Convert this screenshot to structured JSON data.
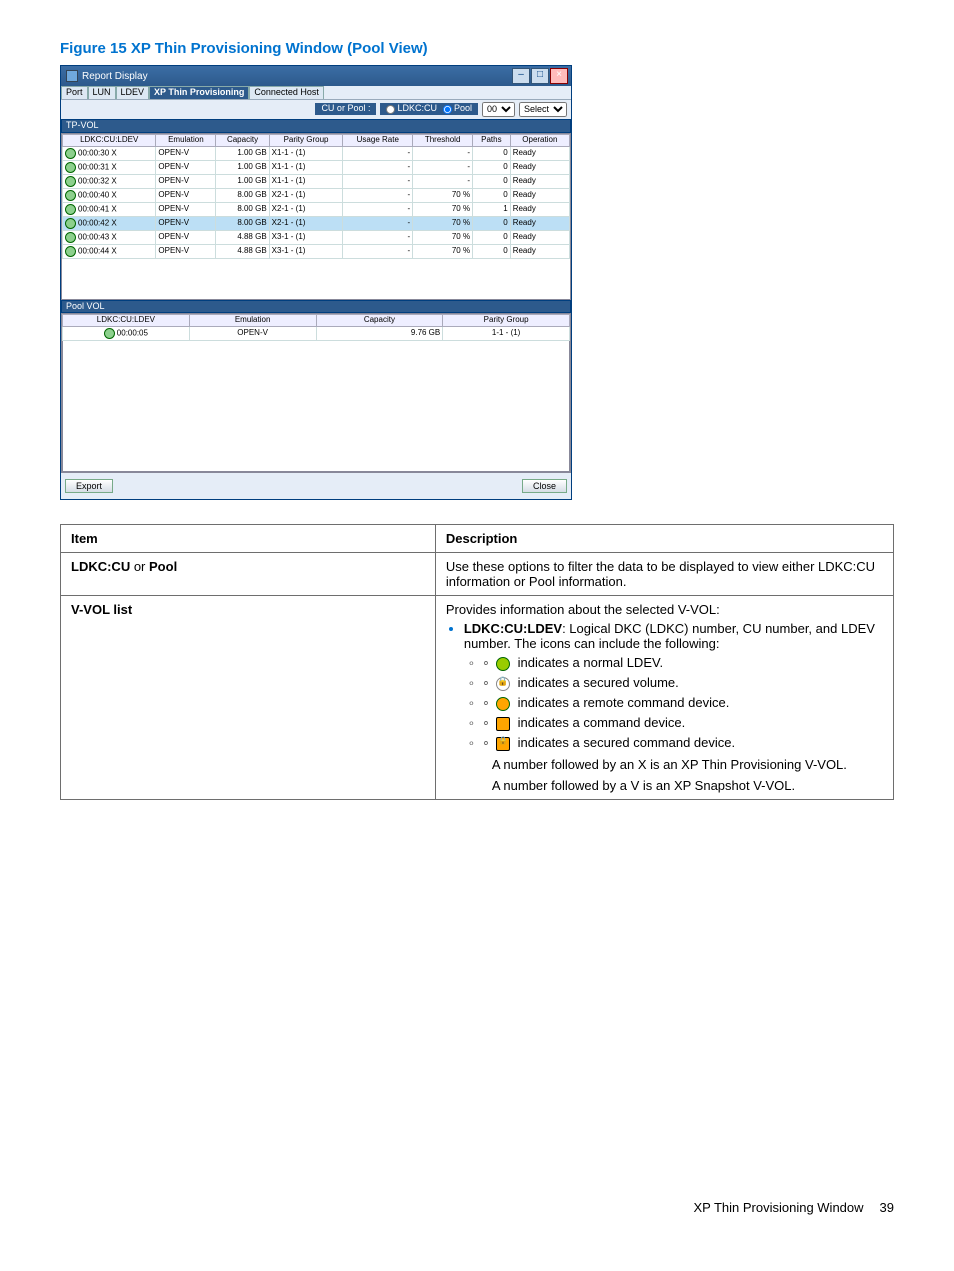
{
  "figure_caption": "Figure 15 XP Thin Provisioning Window (Pool View)",
  "window": {
    "title": "Report Display",
    "minimize": "–",
    "maximize": "□",
    "close": "×"
  },
  "tabs": {
    "port": "Port",
    "lun": "LUN",
    "ldev": "LDEV",
    "xp": "XP Thin Provisioning",
    "connected": "Connected Host"
  },
  "filter": {
    "label": "CU or Pool :",
    "radio_ldkc": "LDKC:CU",
    "radio_pool": "Pool",
    "cu_value": "00",
    "select_label": "Select"
  },
  "tpvol_header": "TP-VOL",
  "tpvol_cols": {
    "ldev": "LDKC:CU:LDEV",
    "emu": "Emulation",
    "cap": "Capacity",
    "pg": "Parity Group",
    "usage": "Usage Rate",
    "thr": "Threshold",
    "paths": "Paths",
    "op": "Operation"
  },
  "tpvol_rows": [
    {
      "ldev": "00:00:30 X",
      "emu": "OPEN-V",
      "cap": "1.00 GB",
      "pg": "X1-1 - (1)",
      "usage": "-",
      "thr": "-",
      "paths": "0",
      "op": "Ready",
      "hl": false
    },
    {
      "ldev": "00:00:31 X",
      "emu": "OPEN-V",
      "cap": "1.00 GB",
      "pg": "X1-1 - (1)",
      "usage": "-",
      "thr": "-",
      "paths": "0",
      "op": "Ready",
      "hl": false
    },
    {
      "ldev": "00:00:32 X",
      "emu": "OPEN-V",
      "cap": "1.00 GB",
      "pg": "X1-1 - (1)",
      "usage": "-",
      "thr": "-",
      "paths": "0",
      "op": "Ready",
      "hl": false
    },
    {
      "ldev": "00:00:40 X",
      "emu": "OPEN-V",
      "cap": "8.00 GB",
      "pg": "X2-1 - (1)",
      "usage": "-",
      "thr": "70 %",
      "paths": "0",
      "op": "Ready",
      "hl": false
    },
    {
      "ldev": "00:00:41 X",
      "emu": "OPEN-V",
      "cap": "8.00 GB",
      "pg": "X2-1 - (1)",
      "usage": "-",
      "thr": "70 %",
      "paths": "1",
      "op": "Ready",
      "hl": false
    },
    {
      "ldev": "00:00:42 X",
      "emu": "OPEN-V",
      "cap": "8.00 GB",
      "pg": "X2-1 - (1)",
      "usage": "-",
      "thr": "70 %",
      "paths": "0",
      "op": "Ready",
      "hl": true
    },
    {
      "ldev": "00:00:43 X",
      "emu": "OPEN-V",
      "cap": "4.88 GB",
      "pg": "X3-1 - (1)",
      "usage": "-",
      "thr": "70 %",
      "paths": "0",
      "op": "Ready",
      "hl": false
    },
    {
      "ldev": "00:00:44 X",
      "emu": "OPEN-V",
      "cap": "4.88 GB",
      "pg": "X3-1 - (1)",
      "usage": "-",
      "thr": "70 %",
      "paths": "0",
      "op": "Ready",
      "hl": false
    }
  ],
  "poolvol_header": "Pool VOL",
  "poolvol_cols": {
    "ldev": "LDKC:CU:LDEV",
    "emu": "Emulation",
    "cap": "Capacity",
    "pg": "Parity Group"
  },
  "poolvol_rows": [
    {
      "ldev": "00:00:05",
      "emu": "OPEN-V",
      "cap": "9.76 GB",
      "pg": "1-1 - (1)"
    }
  ],
  "buttons": {
    "export": "Export",
    "close": "Close"
  },
  "desc_headers": {
    "item": "Item",
    "desc": "Description"
  },
  "desc_rows": {
    "row1_item_a": "LDKC:CU",
    "row1_item_or": " or ",
    "row1_item_b": "Pool",
    "row1_desc": "Use these options to filter the data to be displayed to view either LDKC:CU information or Pool information.",
    "row2_item": "V-VOL list",
    "row2_intro": "Provides information about the selected V-VOL:",
    "row2_ldkc_label": "LDKC:CU:LDEV",
    "row2_ldkc_text": ": Logical DKC (LDKC) number, CU number, and LDEV number. The icons can include the following:",
    "ic_normal": " indicates a normal LDEV.",
    "ic_secured": " indicates a secured volume.",
    "ic_remote": " indicates a remote command device.",
    "ic_cmd": " indicates a command device.",
    "ic_seccmd": " indicates a secured command device.",
    "note1": "A number followed by an X is an XP Thin Provisioning V-VOL.",
    "note2": "A number followed by a V is an XP Snapshot V-VOL."
  },
  "footer": {
    "section": "XP Thin Provisioning Window",
    "page": "39"
  }
}
